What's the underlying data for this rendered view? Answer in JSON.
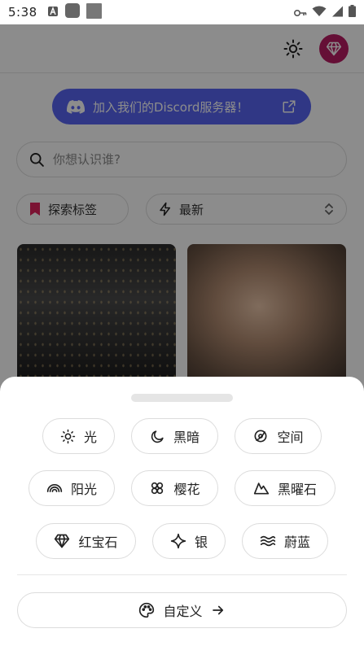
{
  "status_bar": {
    "time": "5:38",
    "icons_left": [
      "text-a-icon",
      "app-square-icon",
      "photo-square-icon"
    ],
    "icons_right": [
      "key-icon",
      "wifi-icon",
      "signal-icon",
      "battery-icon"
    ]
  },
  "background": {
    "discord_banner": "加入我们的Discord服务器！",
    "search_placeholder": "你想认识谁?",
    "tags_button": "探索标签",
    "sort_label": "最新"
  },
  "theme_sheet": {
    "themes": [
      {
        "id": "light",
        "label": "光",
        "icon": "sun-icon"
      },
      {
        "id": "dark",
        "label": "黑暗",
        "icon": "moon-icon"
      },
      {
        "id": "space",
        "label": "空间",
        "icon": "planet-icon"
      },
      {
        "id": "sunshine",
        "label": "阳光",
        "icon": "rainbow-icon"
      },
      {
        "id": "sakura",
        "label": "樱花",
        "icon": "flower-icon"
      },
      {
        "id": "obsidian",
        "label": "黑曜石",
        "icon": "mountain-icon"
      },
      {
        "id": "ruby",
        "label": "红宝石",
        "icon": "gem-icon"
      },
      {
        "id": "silver",
        "label": "银",
        "icon": "sparkle-icon"
      },
      {
        "id": "azure",
        "label": "蔚蓝",
        "icon": "waves-icon"
      }
    ],
    "custom_label": "自定义"
  },
  "colors": {
    "discord": "#5865f2",
    "avatar_gem": "#b91c63"
  }
}
